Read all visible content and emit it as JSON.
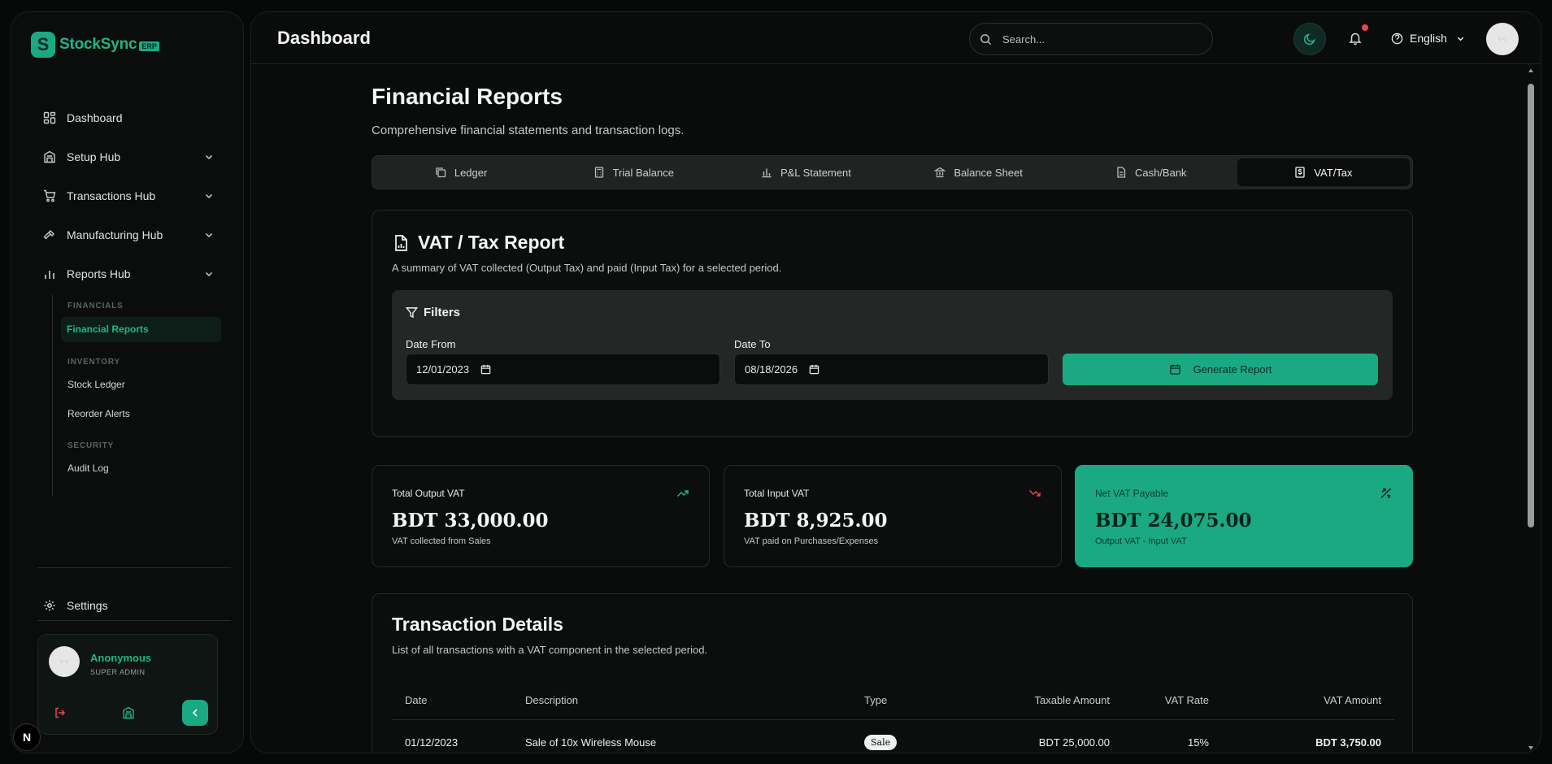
{
  "app": {
    "name": "StockSync",
    "badge": "ERP"
  },
  "sidebar": {
    "items": [
      {
        "label": "Dashboard",
        "icon": "dashboard-grid-icon"
      },
      {
        "label": "Setup Hub",
        "icon": "building-icon"
      },
      {
        "label": "Transactions Hub",
        "icon": "cart-icon"
      },
      {
        "label": "Manufacturing Hub",
        "icon": "hammer-icon"
      },
      {
        "label": "Reports Hub",
        "icon": "bar-chart-icon"
      }
    ],
    "reports_groups": [
      {
        "heading": "FINANCIALS",
        "items": [
          "Financial Reports"
        ]
      },
      {
        "heading": "INVENTORY",
        "items": [
          "Stock Ledger",
          "Reorder Alerts"
        ]
      },
      {
        "heading": "SECURITY",
        "items": [
          "Audit Log"
        ]
      }
    ],
    "settings_label": "Settings",
    "user": {
      "name": "Anonymous",
      "role": "SUPER ADMIN"
    }
  },
  "header": {
    "title": "Dashboard",
    "search_placeholder": "Search...",
    "language": "English"
  },
  "page": {
    "title": "Financial Reports",
    "subtitle": "Comprehensive financial statements and transaction logs.",
    "tabs": [
      {
        "label": "Ledger",
        "icon": "copy-icon"
      },
      {
        "label": "Trial Balance",
        "icon": "calculator-icon"
      },
      {
        "label": "P&L Statement",
        "icon": "bar-chart-icon"
      },
      {
        "label": "Balance Sheet",
        "icon": "bank-icon"
      },
      {
        "label": "Cash/Bank",
        "icon": "document-icon"
      },
      {
        "label": "VAT/Tax",
        "icon": "receipt-dollar-icon"
      }
    ],
    "active_tab": "VAT/Tax"
  },
  "report": {
    "title": "VAT / Tax Report",
    "description": "A summary of VAT collected (Output Tax) and paid (Input Tax) for a selected period.",
    "filters": {
      "title": "Filters",
      "date_from_label": "Date From",
      "date_from_value": "12/01/2023",
      "date_to_label": "Date To",
      "date_to_value": "08/18/2026",
      "generate_label": "Generate Report"
    }
  },
  "stats": [
    {
      "label": "Total Output VAT",
      "value": "BDT 33,000.00",
      "note": "VAT collected from Sales",
      "icon": "trending-up-icon",
      "icon_color": "#22b488"
    },
    {
      "label": "Total Input VAT",
      "value": "BDT 8,925.00",
      "note": "VAT paid on Purchases/Expenses",
      "icon": "trending-down-icon",
      "icon_color": "#e5484d"
    },
    {
      "label": "Net VAT Payable",
      "value": "BDT 24,075.00",
      "note": "Output VAT - Input VAT",
      "icon": "scale-icon",
      "icon_color": "#072219"
    }
  ],
  "transactions": {
    "title": "Transaction Details",
    "description": "List of all transactions with a VAT component in the selected period.",
    "columns": [
      "Date",
      "Description",
      "Type",
      "Taxable Amount",
      "VAT Rate",
      "VAT Amount"
    ],
    "rows": [
      {
        "date": "01/12/2023",
        "description": "Sale of 10x Wireless Mouse",
        "type": "Sale",
        "taxable": "BDT 25,000.00",
        "rate": "15%",
        "vat": "BDT 3,750.00"
      }
    ]
  },
  "colors": {
    "accent": "#1aa982",
    "accent_text": "#22b488",
    "danger": "#e5484d",
    "background": "#070808"
  }
}
